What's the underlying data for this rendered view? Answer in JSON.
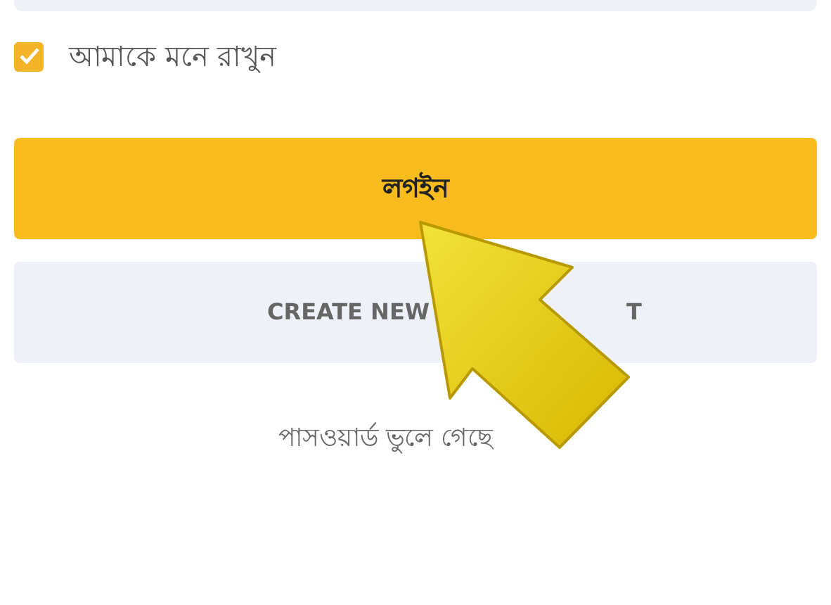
{
  "remember_me": {
    "label": "আমাকে মনে রাখুন",
    "checked": true
  },
  "login_button": {
    "label": "লগইন"
  },
  "create_account_button": {
    "label": "CREATE NEW",
    "label_tail": "T"
  },
  "forgot_password": {
    "label": "পাসওয়ার্ড ভুলে গেছে"
  }
}
